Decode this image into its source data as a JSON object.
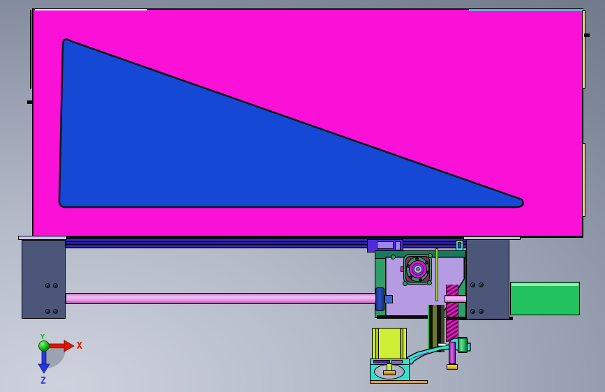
{
  "view": {
    "type": "cad-3d-viewport",
    "projection": "front"
  },
  "triad": {
    "x_label": "X",
    "y_label": "Y",
    "z_label": "Z"
  },
  "colors": {
    "bg_light": "#ced2dd",
    "bg_dark": "#6e7787",
    "panel_magenta": "#fb10d8",
    "pocket_blue": "#1548d4",
    "edge_peach": "#f0c8a0",
    "rail_indigo": "#3a28c9",
    "carriage_blue": "#4f2bd9",
    "carriage_violet": "#9a86ef",
    "cyan_bright": "#35dfcf",
    "bracket_slate": "#4b5679",
    "plate_green": "#2f9e6a",
    "plate_teal": "#177a58",
    "plate_purple": "#b59be2",
    "flange_maroon": "#8e2660",
    "flange_magenta": "#e414c8",
    "flange_ring_purple": "#8c2fd0",
    "rod_yellowgreen": "#9ad12f",
    "screw_pink": "#e89ae8",
    "collar_blue": "#2b4fc0",
    "spring_magenta": "#e020c0",
    "shaft_purple": "#c23fd6",
    "washer_gold": "#e8c520",
    "cylinder_green": "#2ec768",
    "motor_yellowgreen": "#cdf036",
    "strip_indigo": "#4a2fb8",
    "strip_violet": "#8a70e8",
    "washer_orange": "#e09030",
    "base_tan": "#d8a24c",
    "block_green": "#22c25e",
    "axis_x_red": "#e01800",
    "axis_y_green": "#18b018",
    "axis_z_blue": "#2838e0"
  },
  "parts": [
    {
      "label": "work panel",
      "color_ref": "panel_magenta"
    },
    {
      "label": "triangular pocket",
      "color_ref": "pocket_blue"
    },
    {
      "label": "linear rail",
      "color_ref": "rail_indigo"
    },
    {
      "label": "rail carriage",
      "color_ref": "carriage_blue"
    },
    {
      "label": "left end bracket",
      "color_ref": "bracket_slate"
    },
    {
      "label": "right end bracket",
      "color_ref": "bracket_slate"
    },
    {
      "label": "lead screw",
      "color_ref": "screw_pink"
    },
    {
      "label": "gearbox plate",
      "color_ref": "plate_purple"
    },
    {
      "label": "bearing flange",
      "color_ref": "flange_magenta"
    },
    {
      "label": "coil spring",
      "color_ref": "spring_magenta"
    },
    {
      "label": "guide cylinder",
      "color_ref": "cylinder_green"
    },
    {
      "label": "support arm",
      "color_ref": "cyan_bright"
    },
    {
      "label": "stepper motor",
      "color_ref": "motor_yellowgreen"
    },
    {
      "label": "motor foot bracket",
      "color_ref": "cyan_bright"
    },
    {
      "label": "side block",
      "color_ref": "block_green"
    }
  ]
}
